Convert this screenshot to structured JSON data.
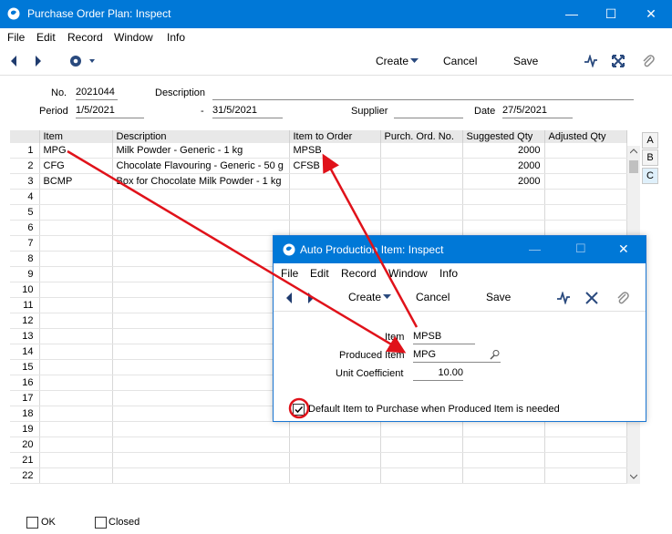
{
  "window": {
    "title": "Purchase Order Plan: Inspect"
  },
  "menu": [
    "File",
    "Edit",
    "Record",
    "Window",
    "Info"
  ],
  "toolbar": {
    "create_label": "Create",
    "cancel_label": "Cancel",
    "save_label": "Save"
  },
  "header": {
    "no_label": "No.",
    "no_value": "2021044",
    "description_label": "Description",
    "description_value": "",
    "period_label": "Period",
    "period_from": "1/5/2021",
    "period_sep": "-",
    "period_to": "31/5/2021",
    "supplier_label": "Supplier",
    "supplier_value": "",
    "date_label": "Date",
    "date_value": "27/5/2021"
  },
  "table": {
    "columns": [
      "",
      "Item",
      "Description",
      "Item to Order",
      "Purch. Ord. No.",
      "Suggested Qty",
      "Adjusted Qty"
    ],
    "rows": [
      [
        "1",
        "MPG",
        "Milk Powder - Generic - 1 kg",
        "MPSB",
        "",
        "2000",
        ""
      ],
      [
        "2",
        "CFG",
        "Chocolate Flavouring - Generic - 50 g",
        "CFSB",
        "",
        "2000",
        ""
      ],
      [
        "3",
        "BCMP",
        "Box for Chocolate Milk Powder - 1 kg",
        "",
        "",
        "2000",
        ""
      ],
      [
        "4",
        "",
        "",
        "",
        "",
        "",
        ""
      ],
      [
        "5",
        "",
        "",
        "",
        "",
        "",
        ""
      ],
      [
        "6",
        "",
        "",
        "",
        "",
        "",
        ""
      ],
      [
        "7",
        "",
        "",
        "",
        "",
        "",
        ""
      ],
      [
        "8",
        "",
        "",
        "",
        "",
        "",
        ""
      ],
      [
        "9",
        "",
        "",
        "",
        "",
        "",
        ""
      ],
      [
        "10",
        "",
        "",
        "",
        "",
        "",
        ""
      ],
      [
        "11",
        "",
        "",
        "",
        "",
        "",
        ""
      ],
      [
        "12",
        "",
        "",
        "",
        "",
        "",
        ""
      ],
      [
        "13",
        "",
        "",
        "",
        "",
        "",
        ""
      ],
      [
        "14",
        "",
        "",
        "",
        "",
        "",
        ""
      ],
      [
        "15",
        "",
        "",
        "",
        "",
        "",
        ""
      ],
      [
        "16",
        "",
        "",
        "",
        "",
        "",
        ""
      ],
      [
        "17",
        "",
        "",
        "",
        "",
        "",
        ""
      ],
      [
        "18",
        "",
        "",
        "",
        "",
        "",
        ""
      ],
      [
        "19",
        "",
        "",
        "",
        "",
        "",
        ""
      ],
      [
        "20",
        "",
        "",
        "",
        "",
        "",
        ""
      ],
      [
        "21",
        "",
        "",
        "",
        "",
        "",
        ""
      ],
      [
        "22",
        "",
        "",
        "",
        "",
        "",
        ""
      ]
    ],
    "side_tabs": [
      "A",
      "B",
      "C"
    ]
  },
  "footer": {
    "ok_label": "OK",
    "closed_label": "Closed"
  },
  "dialog": {
    "title": "Auto Production Item: Inspect",
    "menu": [
      "File",
      "Edit",
      "Record",
      "Window",
      "Info"
    ],
    "create_label": "Create",
    "cancel_label": "Cancel",
    "save_label": "Save",
    "item_label": "Item",
    "item_value": "MPSB",
    "produced_item_label": "Produced Item",
    "produced_item_value": "MPG",
    "unit_coefficient_label": "Unit Coefficient",
    "unit_coefficient_value": "10.00",
    "default_label": "Default Item to Purchase when Produced Item is needed",
    "default_checked": true
  },
  "colors": {
    "titlebar": "#0078d7",
    "annotation": "#e0121a"
  }
}
